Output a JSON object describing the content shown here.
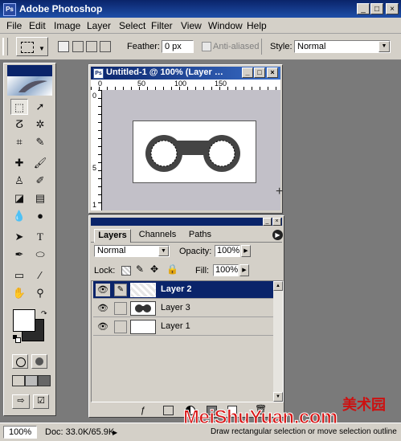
{
  "app": {
    "title": "Adobe Photoshop",
    "icon_text": "Ps"
  },
  "window_buttons": {
    "minimize": "_",
    "maximize": "□",
    "close": "×"
  },
  "menu": [
    "File",
    "Edit",
    "Image",
    "Layer",
    "Select",
    "Filter",
    "View",
    "Window",
    "Help"
  ],
  "options": {
    "feather_label": "Feather:",
    "feather_value": "0 px",
    "antialiased_label": "Anti-aliased",
    "style_label": "Style:",
    "style_value": "Normal"
  },
  "document": {
    "title": "Untitled-1 @ 100% (Layer …",
    "ruler_h": [
      "0",
      "50",
      "100",
      "150"
    ],
    "ruler_v": [
      "0",
      "5",
      "1"
    ]
  },
  "layers_panel": {
    "tabs": [
      "Layers",
      "Channels",
      "Paths"
    ],
    "blend_mode": "Normal",
    "opacity_label": "Opacity:",
    "opacity_value": "100%",
    "lock_label": "Lock:",
    "fill_label": "Fill:",
    "fill_value": "100%",
    "layers": [
      {
        "name": "Layer 2",
        "selected": true
      },
      {
        "name": "Layer 3",
        "selected": false
      },
      {
        "name": "Layer 1",
        "selected": false
      }
    ]
  },
  "status": {
    "zoom": "100%",
    "doc": "Doc: 33.0K/65.9K",
    "hint": "Draw rectangular selection or move selection outline"
  },
  "watermark": {
    "cn": "美术园",
    "latin": "MeiShuYuan.com"
  },
  "colors": {
    "title_bar": "#0a246a",
    "selection": "#0a246a",
    "chrome": "#d4d0c8",
    "foreground": "#ffffff",
    "background": "#2a2a2a",
    "watermark": "#cc1111"
  }
}
